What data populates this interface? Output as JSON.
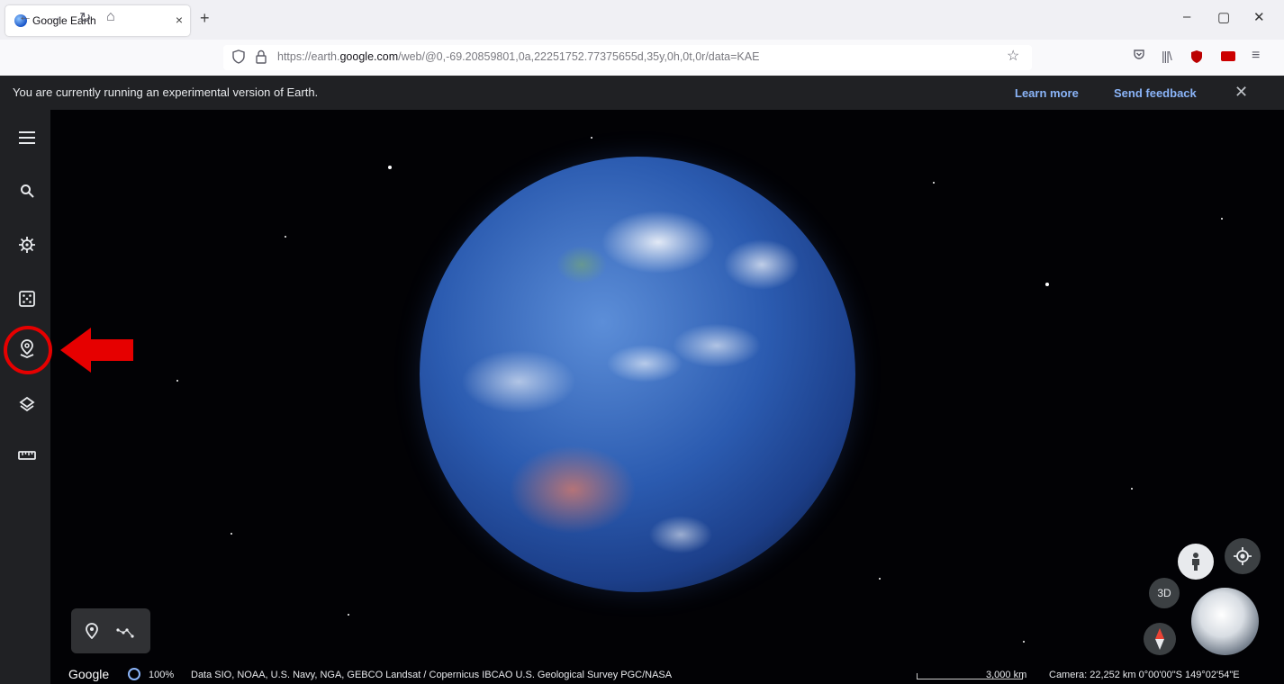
{
  "browser": {
    "tab_title": "Google Earth",
    "tab_close": "×",
    "new_tab": "+",
    "url_prefix": "https://earth.",
    "url_host": "google.com",
    "url_path": "/web/@0,-69.20859801,0a,22251752.77375655d,35y,0h,0t,0r/data=KAE",
    "window_controls": [
      "–",
      "▢",
      "✕"
    ]
  },
  "banner": {
    "text": "You are currently running an experimental version of Earth.",
    "learn_more": "Learn more",
    "send_feedback": "Send feedback",
    "close": "✕"
  },
  "sidebar": {
    "items": [
      {
        "icon": "menu-icon"
      },
      {
        "icon": "search-icon"
      },
      {
        "icon": "voyager-icon"
      },
      {
        "icon": "dice-icon"
      },
      {
        "icon": "projects-icon"
      },
      {
        "icon": "layers-icon"
      },
      {
        "icon": "measure-icon"
      }
    ]
  },
  "bottom": {
    "google": "Google",
    "percent": "100%",
    "credits": "Data SIO, NOAA, U.S. Navy, NGA, GEBCO  Landsat / Copernicus  IBCAO  U.S. Geological Survey  PGC/NASA",
    "scale": "3,000 km",
    "camera": "Camera: 22,252 km   0°00'00\"S 149°02'54\"E",
    "view_3d": "3D"
  },
  "colors": {
    "banner_bg": "#202124",
    "link": "#8ab4f8",
    "annotation": "#e60000"
  }
}
